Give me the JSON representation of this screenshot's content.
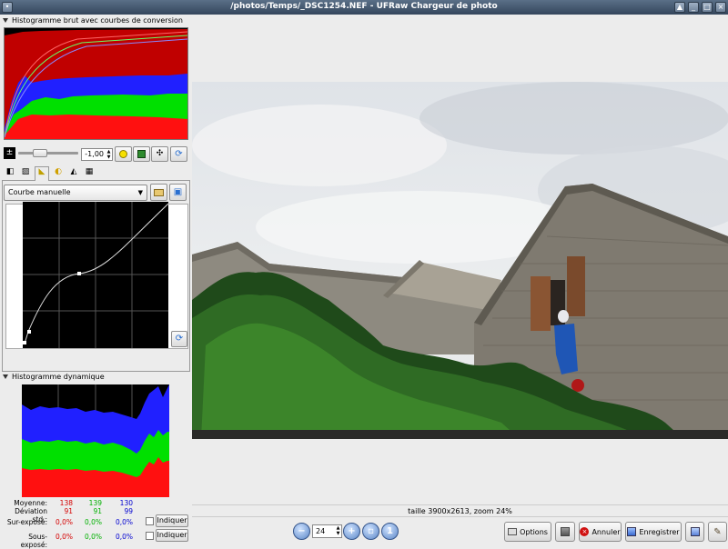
{
  "window": {
    "title": "/photos/Temps/_DSC1254.NEF - UFRaw Chargeur de photo"
  },
  "raw_histogram": {
    "title": "Histogramme brut avec courbes de conversion"
  },
  "exposure": {
    "value": "-1,00"
  },
  "curve": {
    "selected": "Courbe manuelle"
  },
  "live_histogram": {
    "title": "Histogramme dynamique",
    "stats": {
      "mean_label": "Moyenne:",
      "std_label": "Déviation std.:",
      "over_label": "Sur-exposé:",
      "under_label": "Sous-exposé:",
      "mean": [
        "138",
        "139",
        "130"
      ],
      "std": [
        "91",
        "91",
        "99"
      ],
      "over": [
        "0,0%",
        "0,0%",
        "0,0%"
      ],
      "under": [
        "0,0%",
        "0,0%",
        "0,0%"
      ],
      "indicate_label": "Indiquer"
    }
  },
  "status": {
    "size_zoom": "taille 3900x2613, zoom 24%"
  },
  "toolbar": {
    "zoom_value": "24",
    "options_label": "Options",
    "cancel_label": "Annuler",
    "save_label": "Enregistrer"
  },
  "colors": {
    "red": "#d40000",
    "green": "#00b000",
    "blue": "#0000d0",
    "titlebar": "#3f5269"
  }
}
